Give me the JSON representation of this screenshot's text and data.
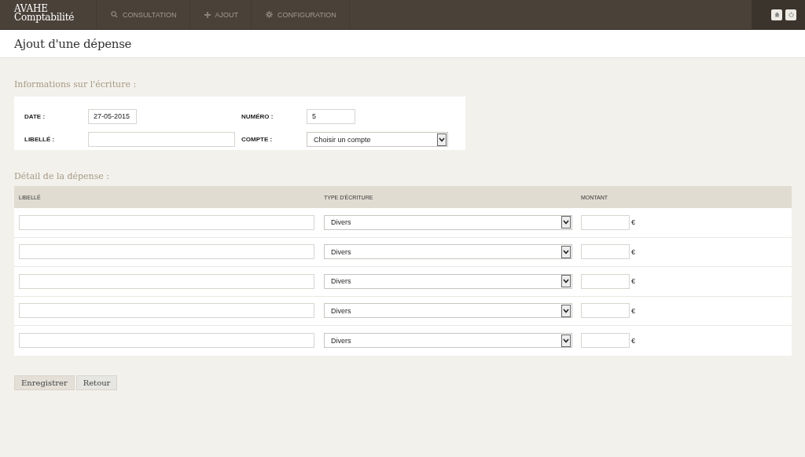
{
  "brand": {
    "line_1": "AVAHE",
    "line_2": "Comptabilité"
  },
  "nav": [
    {
      "label": "CONSULTATION",
      "selected": false
    },
    {
      "label": "AJOUT",
      "selected": false
    },
    {
      "label": "CONFIGURATION",
      "selected": false
    }
  ],
  "page_title": "Ajout d'une dépense",
  "info_section": {
    "heading": "Informations sur l'écriture :",
    "fields": [
      {
        "label": "DATE :",
        "kind": "input",
        "value": "27-05-2015"
      },
      {
        "label": "NUMÉRO :",
        "kind": "input",
        "value": "5"
      },
      {
        "label": "LIBELLÉ :",
        "kind": "input"
      },
      {
        "label": "COMPTE :",
        "kind": "select",
        "value": "Choisir un compte"
      }
    ]
  },
  "detail_section": {
    "heading": "Détail de la dépense :",
    "columns": [
      "LIBELLÉ",
      "TYPE D'ÉCRITURE",
      "MONTANT"
    ],
    "rows": [
      {
        "type": "Divers",
        "currency": "€"
      },
      {
        "type": "Divers",
        "currency": "€"
      },
      {
        "type": "Divers",
        "currency": "€"
      },
      {
        "type": "Divers",
        "currency": "€"
      },
      {
        "type": "Divers",
        "currency": "€"
      }
    ]
  },
  "buttons": [
    {
      "label": "Enregistrer",
      "kind": "primary"
    },
    {
      "label": "Retour",
      "kind": "secondary"
    }
  ]
}
